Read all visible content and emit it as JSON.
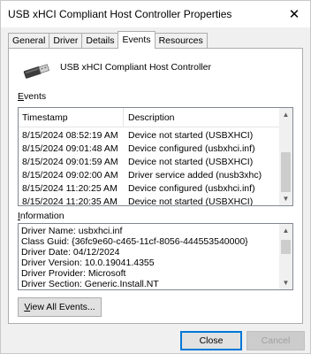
{
  "window": {
    "title": "USB xHCI Compliant Host Controller Properties"
  },
  "tabs": [
    {
      "label": "General"
    },
    {
      "label": "Driver"
    },
    {
      "label": "Details"
    },
    {
      "label": "Events",
      "active": true
    },
    {
      "label": "Resources"
    }
  ],
  "device": {
    "name": "USB xHCI Compliant Host Controller",
    "icon": "usb-connector-icon"
  },
  "events": {
    "label_accel": "E",
    "label_rest": "vents",
    "columns": [
      "Timestamp",
      "Description"
    ],
    "rows": [
      {
        "timestamp": "8/15/2024 08:52:19 AM",
        "description": "Device not started (USBXHCI)"
      },
      {
        "timestamp": "8/15/2024 09:01:48 AM",
        "description": "Device configured (usbxhci.inf)"
      },
      {
        "timestamp": "8/15/2024 09:01:59 AM",
        "description": "Device not started (USBXHCI)"
      },
      {
        "timestamp": "8/15/2024 09:02:00 AM",
        "description": "Driver service added (nusb3xhc)"
      },
      {
        "timestamp": "8/15/2024 11:20:25 AM",
        "description": "Device configured (usbxhci.inf)"
      },
      {
        "timestamp": "8/15/2024 11:20:35 AM",
        "description": "Device not started (USBXHCI)"
      }
    ]
  },
  "information": {
    "label_accel": "I",
    "label_rest": "nformation",
    "lines": [
      "Driver Name: usbxhci.inf",
      "Class Guid: {36fc9e60-c465-11cf-8056-444553540000}",
      "Driver Date: 04/12/2024",
      "Driver Version: 10.0.19041.4355",
      "Driver Provider: Microsoft",
      "Driver Section: Generic.Install.NT"
    ]
  },
  "buttons": {
    "view_all_accel": "V",
    "view_all_rest": "iew All Events...",
    "close": "Close",
    "cancel": "Cancel"
  }
}
